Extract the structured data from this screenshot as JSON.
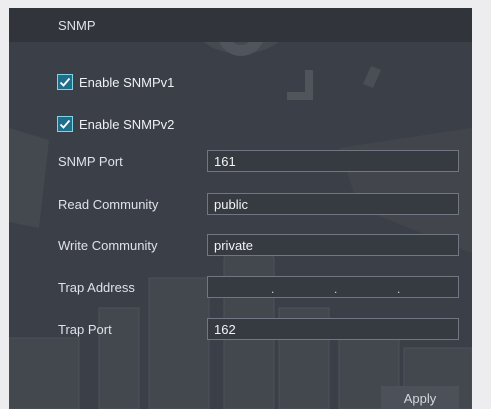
{
  "window": {
    "title": "SNMP"
  },
  "form": {
    "enable_v1": {
      "label": "Enable SNMPv1",
      "checked": true
    },
    "enable_v2": {
      "label": "Enable SNMPv2",
      "checked": true
    },
    "snmp_port": {
      "label": "SNMP Port",
      "value": "161"
    },
    "read_community": {
      "label": "Read Community",
      "value": "public"
    },
    "write_community": {
      "label": "Write Community",
      "value": "private"
    },
    "trap_address": {
      "label": "Trap Address",
      "separators": [
        ".",
        ".",
        "."
      ]
    },
    "trap_port": {
      "label": "Trap Port",
      "value": "162"
    }
  },
  "actions": {
    "apply_label": "Apply"
  },
  "colors": {
    "accent": "#1f6f8b",
    "panel": "#3b3f47",
    "field_border": "#707782"
  }
}
